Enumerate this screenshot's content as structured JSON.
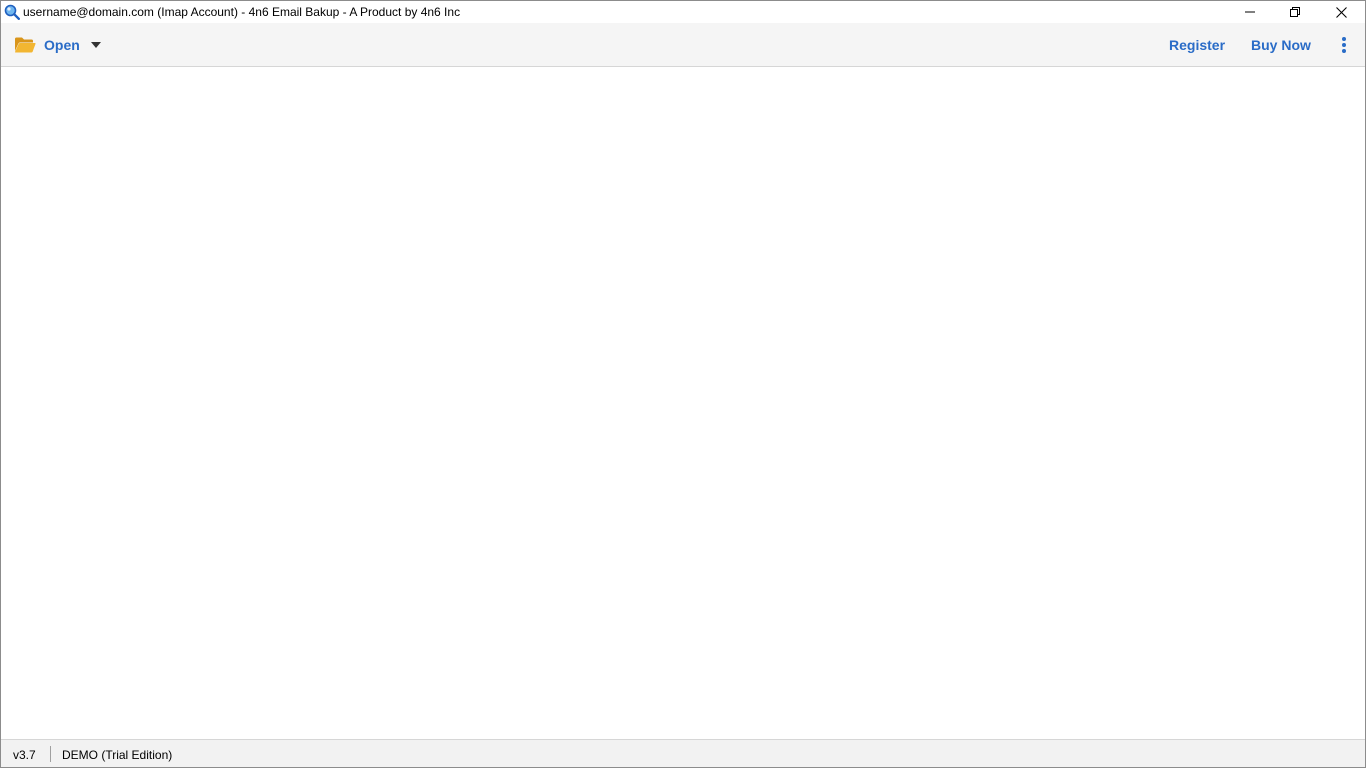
{
  "window": {
    "title": "username@domain.com (Imap Account) - 4n6 Email Bakup - A Product by 4n6 Inc"
  },
  "toolbar": {
    "open_label": "Open",
    "register_label": "Register",
    "buy_now_label": "Buy Now"
  },
  "status": {
    "version": "v3.7",
    "edition": "DEMO (Trial Edition)"
  },
  "icons": {
    "app": "magnifier-icon",
    "open": "folder-open-icon",
    "dropdown": "caret-down-icon",
    "more": "more-vertical-icon",
    "minimize": "minimize-icon",
    "restore": "restore-icon",
    "close": "close-icon"
  },
  "colors": {
    "accent": "#2a6cc7",
    "folder": "#e8a317",
    "toolbar_bg": "#f5f5f5",
    "statusbar_bg": "#f2f2f2"
  }
}
